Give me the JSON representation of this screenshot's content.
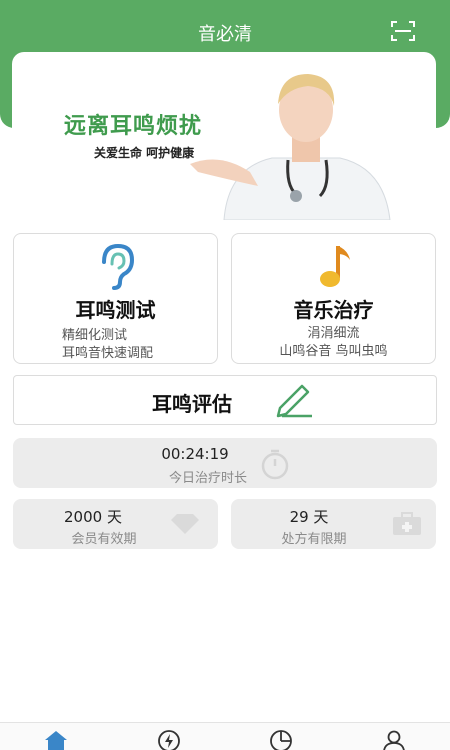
{
  "app": {
    "title": "音必清"
  },
  "icons": {
    "scan": "scan-icon",
    "ear": "ear-icon",
    "music": "music-note-icon",
    "pen": "pen-icon",
    "stopwatch": "stopwatch-icon",
    "diamond": "diamond-icon",
    "medkit": "medical-kit-icon"
  },
  "colors": {
    "brand_green": "#5aab63",
    "accent_blue": "#3a86c8",
    "music_gold": "#e8a928"
  },
  "banner": {
    "slogan": "远离耳鸣烦扰",
    "sub": "关爱生命  呵护健康"
  },
  "cards": [
    {
      "title": "耳鸣测试",
      "line1": "精细化测试",
      "line2": "耳鸣音快速调配"
    },
    {
      "title": "音乐治疗",
      "line1": "涓涓细流",
      "line2": "山鸣谷音 鸟叫虫鸣"
    }
  ],
  "evaluate": {
    "label": "耳鸣评估"
  },
  "stats": {
    "therapy_time": {
      "value": "00:24:19",
      "label": "今日治疗时长"
    },
    "membership": {
      "value": "2000 天",
      "label": "会员有效期"
    },
    "prescription": {
      "value": "29 天",
      "label": "处方有限期"
    }
  },
  "tabs": [
    {
      "icon": "home-icon",
      "active": true
    },
    {
      "icon": "lightning-icon",
      "active": false
    },
    {
      "icon": "pie-chart-icon",
      "active": false
    },
    {
      "icon": "user-icon",
      "active": false
    }
  ]
}
